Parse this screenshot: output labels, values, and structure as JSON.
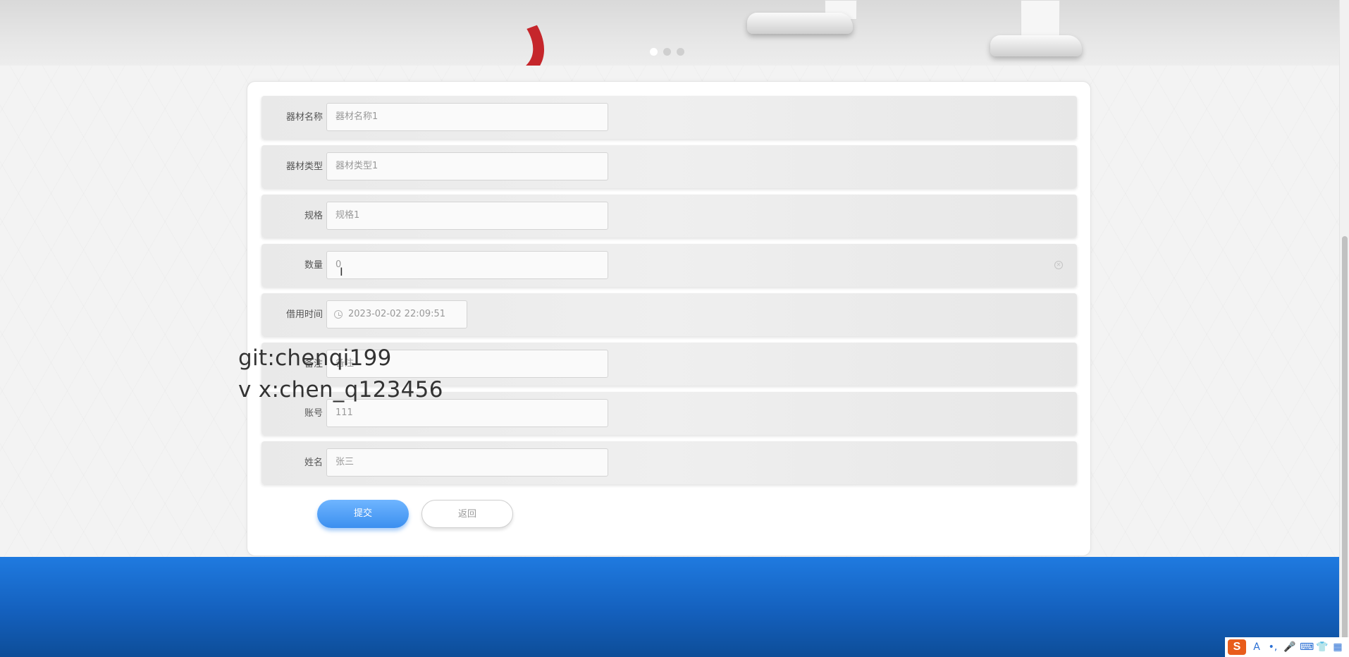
{
  "banner": {
    "carousel_dots": 3,
    "active_dot": 0
  },
  "form": {
    "rows": [
      {
        "label": "器材名称",
        "value": "器材名称1"
      },
      {
        "label": "器材类型",
        "value": "器材类型1"
      },
      {
        "label": "规格",
        "value": "规格1"
      },
      {
        "label": "数量",
        "value": "0"
      },
      {
        "label": "借用时间",
        "value": "2023-02-02 22:09:51"
      },
      {
        "label": "备注",
        "value": "备注"
      },
      {
        "label": "账号",
        "value": "111"
      },
      {
        "label": "姓名",
        "value": "张三"
      }
    ],
    "submit_label": "提交",
    "back_label": "返回"
  },
  "watermark": {
    "line1": "git:chenqi199",
    "line2": "v x:chen_q123456"
  },
  "ime": {
    "logo": "S",
    "mode": "A",
    "punct": "•,",
    "icons": [
      "mic-icon",
      "keyboard-icon",
      "skin-icon",
      "grid-icon"
    ]
  },
  "colors": {
    "primary": "#3b8fef",
    "footer": "#1f7ae0",
    "banner_accent": "#c5262b"
  }
}
